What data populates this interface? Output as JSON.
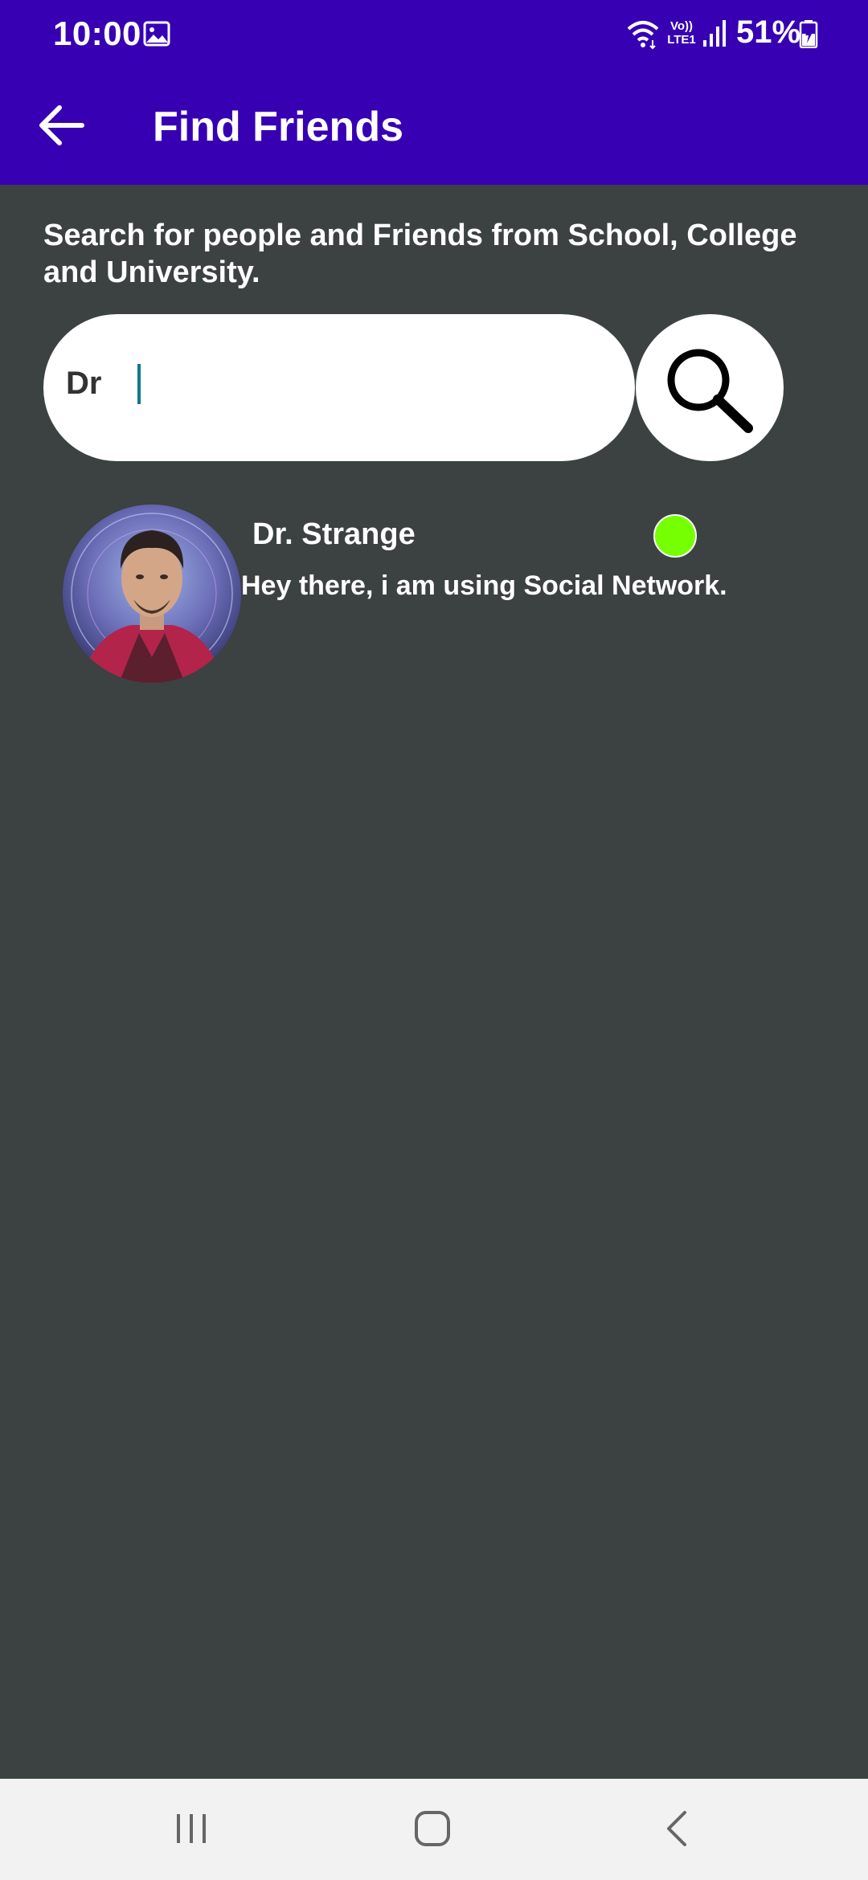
{
  "status_bar": {
    "time": "10:00",
    "icons": [
      "gallery-icon",
      "wifi-icon",
      "lte-icon",
      "signal-icon",
      "battery-icon"
    ],
    "lte_label_top": "Vo))",
    "lte_label_bottom": "LTE1",
    "battery_percent": "51%"
  },
  "app_bar": {
    "back_icon": "arrow-left-icon",
    "title": "Find Friends",
    "background": "#3700b3"
  },
  "description": "Search for people and Friends from School, College and University.",
  "search": {
    "value": "Dr",
    "button_icon": "search-icon"
  },
  "results": [
    {
      "name": "Dr. Strange",
      "status": "Hey there, i am using Social Network.",
      "online": true,
      "online_color": "#76ff03"
    }
  ],
  "nav_bar": {
    "icons": [
      "recents-icon",
      "home-icon",
      "back-icon"
    ]
  },
  "colors": {
    "background": "#3c4142",
    "primary": "#3700b3",
    "text": "#ffffff"
  }
}
